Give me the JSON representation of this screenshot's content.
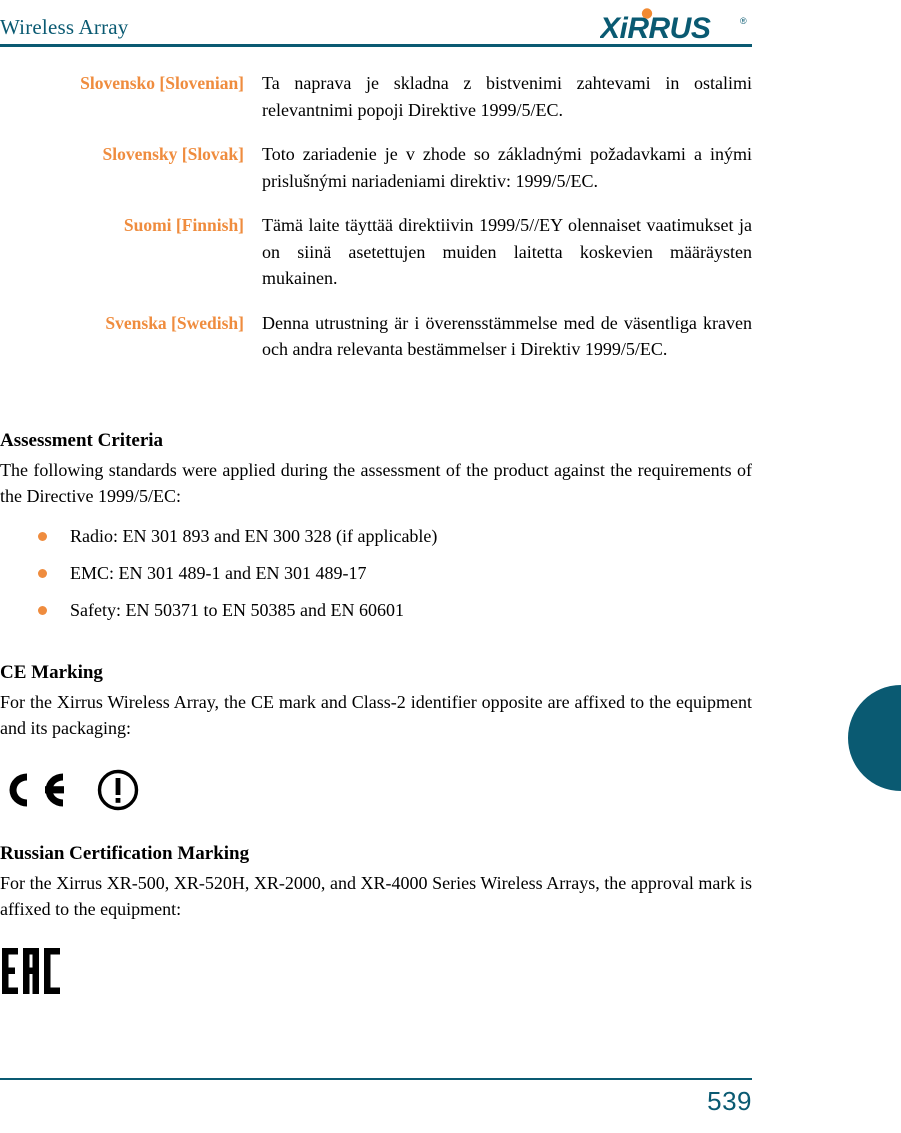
{
  "header": {
    "title": "Wireless Array",
    "logo_text": "XIRRUS",
    "logo_trademark": "®",
    "logo_color": "#0a5a72",
    "logo_dot_color": "#f18a32",
    "rule_color": "#0a5a72"
  },
  "colors": {
    "teal": "#0a5a72",
    "orange": "#ef8c3e",
    "text": "#000000"
  },
  "languages": [
    {
      "label": "Slovensko [Slovenian]",
      "text": "Ta naprava je skladna z bistvenimi zahtevami in ostalimi relevantnimi popoji Direktive 1999/5/EC."
    },
    {
      "label": "Slovensky [Slovak]",
      "text": "Toto zariadenie je v zhode so základnými požadavkami a inými prislušnými nariadeniami direktiv: 1999/5/EC."
    },
    {
      "label": "Suomi [Finnish]",
      "text": "Tämä laite täyttää direktiivin 1999/5//EY olennaiset vaatimukset ja on siinä asetettujen muiden laitetta koskevien määräysten mukainen."
    },
    {
      "label": "Svenska [Swedish]",
      "text": "Denna utrustning är i överensstämmelse med de väsentliga kraven och andra relevanta bestämmelser i Direktiv 1999/5/EC."
    }
  ],
  "assessment": {
    "heading": "Assessment Criteria",
    "intro": "The following standards were applied during the assessment of the product against the requirements of the Directive 1999/5/EC:",
    "items": [
      "Radio: EN 301 893 and EN 300 328 (if applicable)",
      "EMC: EN 301 489-1 and EN 301 489-17",
      "Safety: EN 50371 to EN 50385 and EN 60601"
    ]
  },
  "ce_marking": {
    "heading": "CE Marking",
    "text": "For the Xirrus Wireless Array, the CE mark and Class-2 identifier opposite are affixed to the equipment and its packaging:",
    "ce_mark_name": "ce-mark-icon",
    "class2_name": "class-2-identifier-icon"
  },
  "russian_marking": {
    "heading": "Russian Certification Marking",
    "text": "For the Xirrus XR-500, XR-520H, XR-2000, and XR-4000 Series Wireless Arrays, the approval mark is affixed to the equipment:",
    "eac_mark_name": "eac-mark-icon",
    "eac_letters": "EAC"
  },
  "footer": {
    "page_number": "539"
  }
}
